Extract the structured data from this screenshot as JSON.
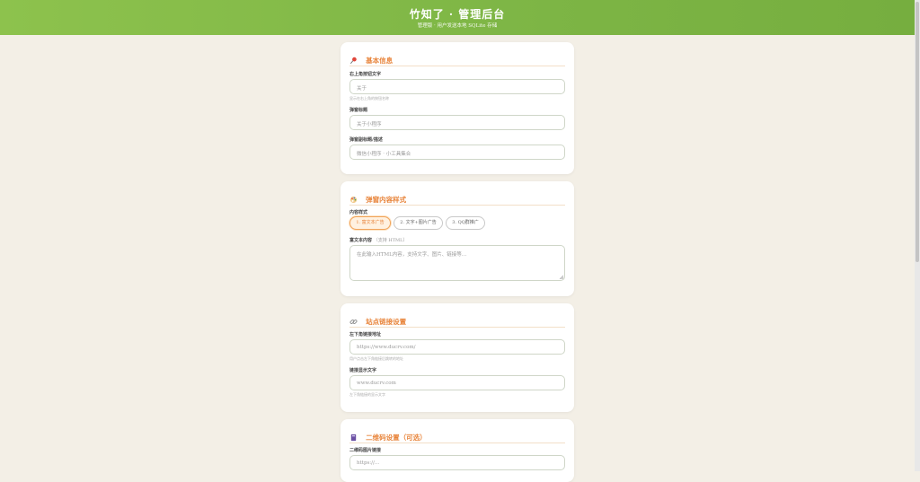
{
  "header": {
    "title": "竹知了 · 管理后台",
    "subtitle": "管理版 · 用户发送本地 SQLite 存储"
  },
  "basic": {
    "title": "基本信息",
    "icon": "pin-icon",
    "fields": [
      {
        "label": "右上角按钮文字",
        "placeholder": "关于",
        "help": "显示在右上角的按钮名称"
      },
      {
        "label": "弹窗标题",
        "placeholder": "关于小程序"
      },
      {
        "label": "弹窗副标题/描述",
        "placeholder": "微信小程序 · 小工具集合"
      }
    ]
  },
  "content": {
    "title": "弹窗内容样式",
    "icon": "palette-icon",
    "style_label": "内容样式",
    "options": [
      "1. 富文本广告",
      "2. 文字+图片广告",
      "3. QQ群推广"
    ],
    "selected_index": 0,
    "rich_label": "富文本内容",
    "rich_hint": "（支持 HTML）",
    "rich_placeholder": "在此输入HTML内容，支持文字、图片、链接等…"
  },
  "link": {
    "title": "站点链接设置",
    "icon": "link-icon",
    "fields": [
      {
        "label": "左下角链接地址",
        "placeholder": "https://www.ducrv.com/",
        "help": "用户点击左下角链接后跳转的地址"
      },
      {
        "label": "链接显示文字",
        "placeholder": "www.ducrv.com",
        "help": "左下角链接的显示文字"
      }
    ]
  },
  "qr": {
    "title": "二维码设置（可选）",
    "icon": "book-icon",
    "field_label": "二维码图片链接",
    "field_placeholder": "https://..."
  },
  "colors": {
    "header": "#7db545",
    "accent": "#e8843a",
    "background": "#f3efe6"
  }
}
